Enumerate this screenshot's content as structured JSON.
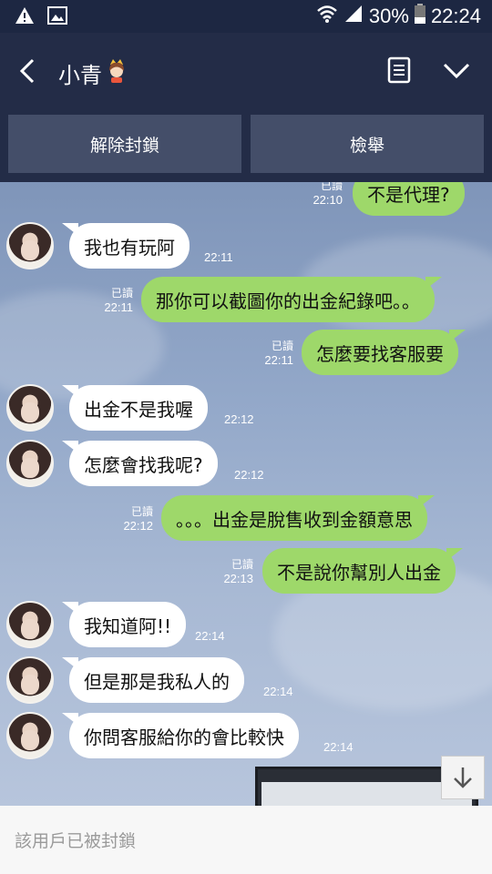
{
  "status_bar": {
    "battery": "30%",
    "time": "22:24"
  },
  "header": {
    "contact_name": "小青"
  },
  "actions": {
    "unblock_label": "解除封鎖",
    "report_label": "檢舉"
  },
  "messages": [
    {
      "text": "不是代理?",
      "read": "已讀",
      "time": "22:10"
    },
    {
      "text": "我也有玩阿",
      "time": "22:11"
    },
    {
      "text": "那你可以截圖你的出金紀錄吧。。",
      "read": "已讀",
      "time": "22:11"
    },
    {
      "text": "怎麼要找客服要",
      "read": "已讀",
      "time": "22:11"
    },
    {
      "text": "出金不是我喔",
      "time": "22:12"
    },
    {
      "text": "怎麼會找我呢?",
      "time": "22:12"
    },
    {
      "text": "。。。出金是脫售收到金額意思",
      "read": "已讀",
      "time": "22:12"
    },
    {
      "text": "不是說你幫別人出金",
      "read": "已讀",
      "time": "22:13"
    },
    {
      "text": "我知道阿!!",
      "time": "22:14"
    },
    {
      "text": "但是那是我私人的",
      "time": "22:14"
    },
    {
      "text": "你問客服給你的會比較快",
      "time": "22:14"
    }
  ],
  "footer": {
    "blocked_notice": "該用戶已被封鎖"
  },
  "colors": {
    "header_bg": "#232c47",
    "outgoing_bubble": "#9ed86a",
    "incoming_bubble": "#ffffff"
  }
}
